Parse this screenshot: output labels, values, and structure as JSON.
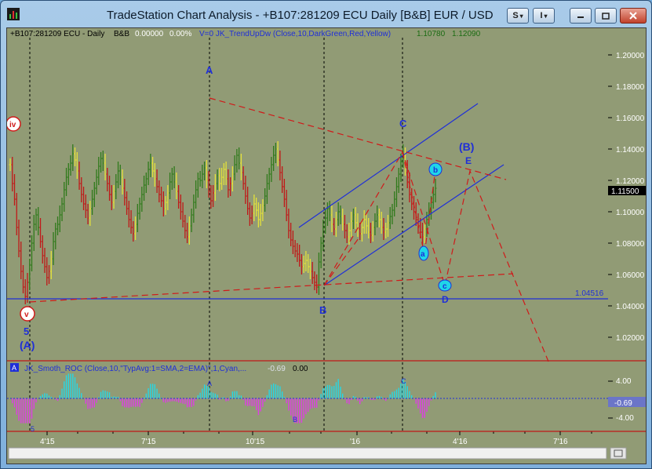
{
  "window": {
    "title": "TradeStation Chart Analysis - +B107:281209 ECU Daily [B&B] EUR / USD",
    "buttons": [
      "S",
      "I"
    ]
  },
  "chart": {
    "header_symbol": "+B107:281209 ECU - Daily",
    "header_bb": "B&B",
    "header_value": "0.00000",
    "header_pct": "0.00%",
    "header_indicator": "V=0  JK_TrendUpDw (Close,10,DarkGreen,Red,Yellow)",
    "header_val1": "1.10780",
    "header_val2": "1.12090",
    "last_price": "1.11500",
    "support_level": "1.04516",
    "wave_labels": {
      "A": "A",
      "B": "B",
      "C": "C",
      "D": "D",
      "E": "E",
      "bigB": "(B)",
      "bigA": "(A)",
      "five": "5",
      "iv": "iv",
      "v": "v",
      "a": "a",
      "b": "b",
      "c": "c"
    },
    "colors": {
      "up": "#2f7a1b",
      "down": "#c01818",
      "flat": "#e5e23a",
      "channel": "#1f2fd8",
      "dash": "#d01a1a"
    }
  },
  "oscillator": {
    "label_box": "A",
    "header": "JK_Smoth_ROC (Close,10,\"TypAvg:1=SMA,2=EMA)\",1,Cyan,...",
    "val1": "-0.69",
    "val2": "0.00",
    "current": "-0.69",
    "labels": {
      "A": "A",
      "B": "B",
      "C": "C",
      "five": "5"
    }
  },
  "chart_data": {
    "type": "line",
    "yaxis_ticks": [
      "1.20000",
      "1.18000",
      "1.16000",
      "1.14000",
      "1.12000",
      "1.10000",
      "1.08000",
      "1.06000",
      "1.04000",
      "1.02000"
    ],
    "ylim": [
      1.0,
      1.207
    ],
    "x": [
      "4'15",
      "7'15",
      "10'15",
      "'16",
      "4'16",
      "7'16"
    ],
    "osc_ticks": [
      "4.00",
      "-4.00"
    ],
    "osc_ylim": [
      -6.0,
      6.0
    ],
    "series": [
      {
        "values": [
          1.13,
          1.118,
          1.108,
          1.09,
          1.075,
          1.062,
          1.052,
          1.046,
          1.055,
          1.066,
          1.08,
          1.092,
          1.098,
          1.09,
          1.081,
          1.072,
          1.065,
          1.058,
          1.062,
          1.07,
          1.081,
          1.089,
          1.092,
          1.098,
          1.105,
          1.114,
          1.122,
          1.127,
          1.131,
          1.137,
          1.133,
          1.126,
          1.118,
          1.111,
          1.105,
          1.101,
          1.096,
          1.102,
          1.108,
          1.115,
          1.122,
          1.129,
          1.134,
          1.131,
          1.124,
          1.118,
          1.111,
          1.106,
          1.113,
          1.119,
          1.126,
          1.122,
          1.115,
          1.109,
          1.102,
          1.095,
          1.09,
          1.086,
          1.092,
          1.099,
          1.105,
          1.111,
          1.117,
          1.121,
          1.127,
          1.131,
          1.126,
          1.121,
          1.116,
          1.111,
          1.107,
          1.102,
          1.106,
          1.112,
          1.119,
          1.124,
          1.119,
          1.113,
          1.106,
          1.1,
          1.094,
          1.088,
          1.084,
          1.091,
          1.098,
          1.106,
          1.114,
          1.121,
          1.12,
          1.124,
          1.128,
          1.12,
          1.113,
          1.107,
          1.112,
          1.118,
          1.123,
          1.118,
          1.122,
          1.127,
          1.121,
          1.114,
          1.118,
          1.124,
          1.13,
          1.136,
          1.131,
          1.125,
          1.118,
          1.11,
          1.102,
          1.096,
          1.099,
          1.105,
          1.101,
          1.095,
          1.099,
          1.104,
          1.11,
          1.118,
          1.124,
          1.13,
          1.136,
          1.14,
          1.133,
          1.125,
          1.116,
          1.108,
          1.098,
          1.088,
          1.082,
          1.078,
          1.075,
          1.073,
          1.069,
          1.065,
          1.067,
          1.069,
          1.065,
          1.062,
          1.058,
          1.055,
          1.052,
          1.068,
          1.08,
          1.09,
          1.096,
          1.102,
          1.098,
          1.092,
          1.089,
          1.095,
          1.1,
          1.097,
          1.092,
          1.088,
          1.084,
          1.088,
          1.094,
          1.098,
          1.093,
          1.089,
          1.086,
          1.09,
          1.095,
          1.091,
          1.087,
          1.085,
          1.09,
          1.094,
          1.098,
          1.095,
          1.09,
          1.087,
          1.089,
          1.093,
          1.097,
          1.101,
          1.108,
          1.116,
          1.124,
          1.132,
          1.137,
          1.128,
          1.119,
          1.111,
          1.105,
          1.1,
          1.095,
          1.091,
          1.087,
          1.084,
          1.089,
          1.095,
          1.1,
          1.106,
          1.111,
          1.115
        ]
      }
    ]
  }
}
